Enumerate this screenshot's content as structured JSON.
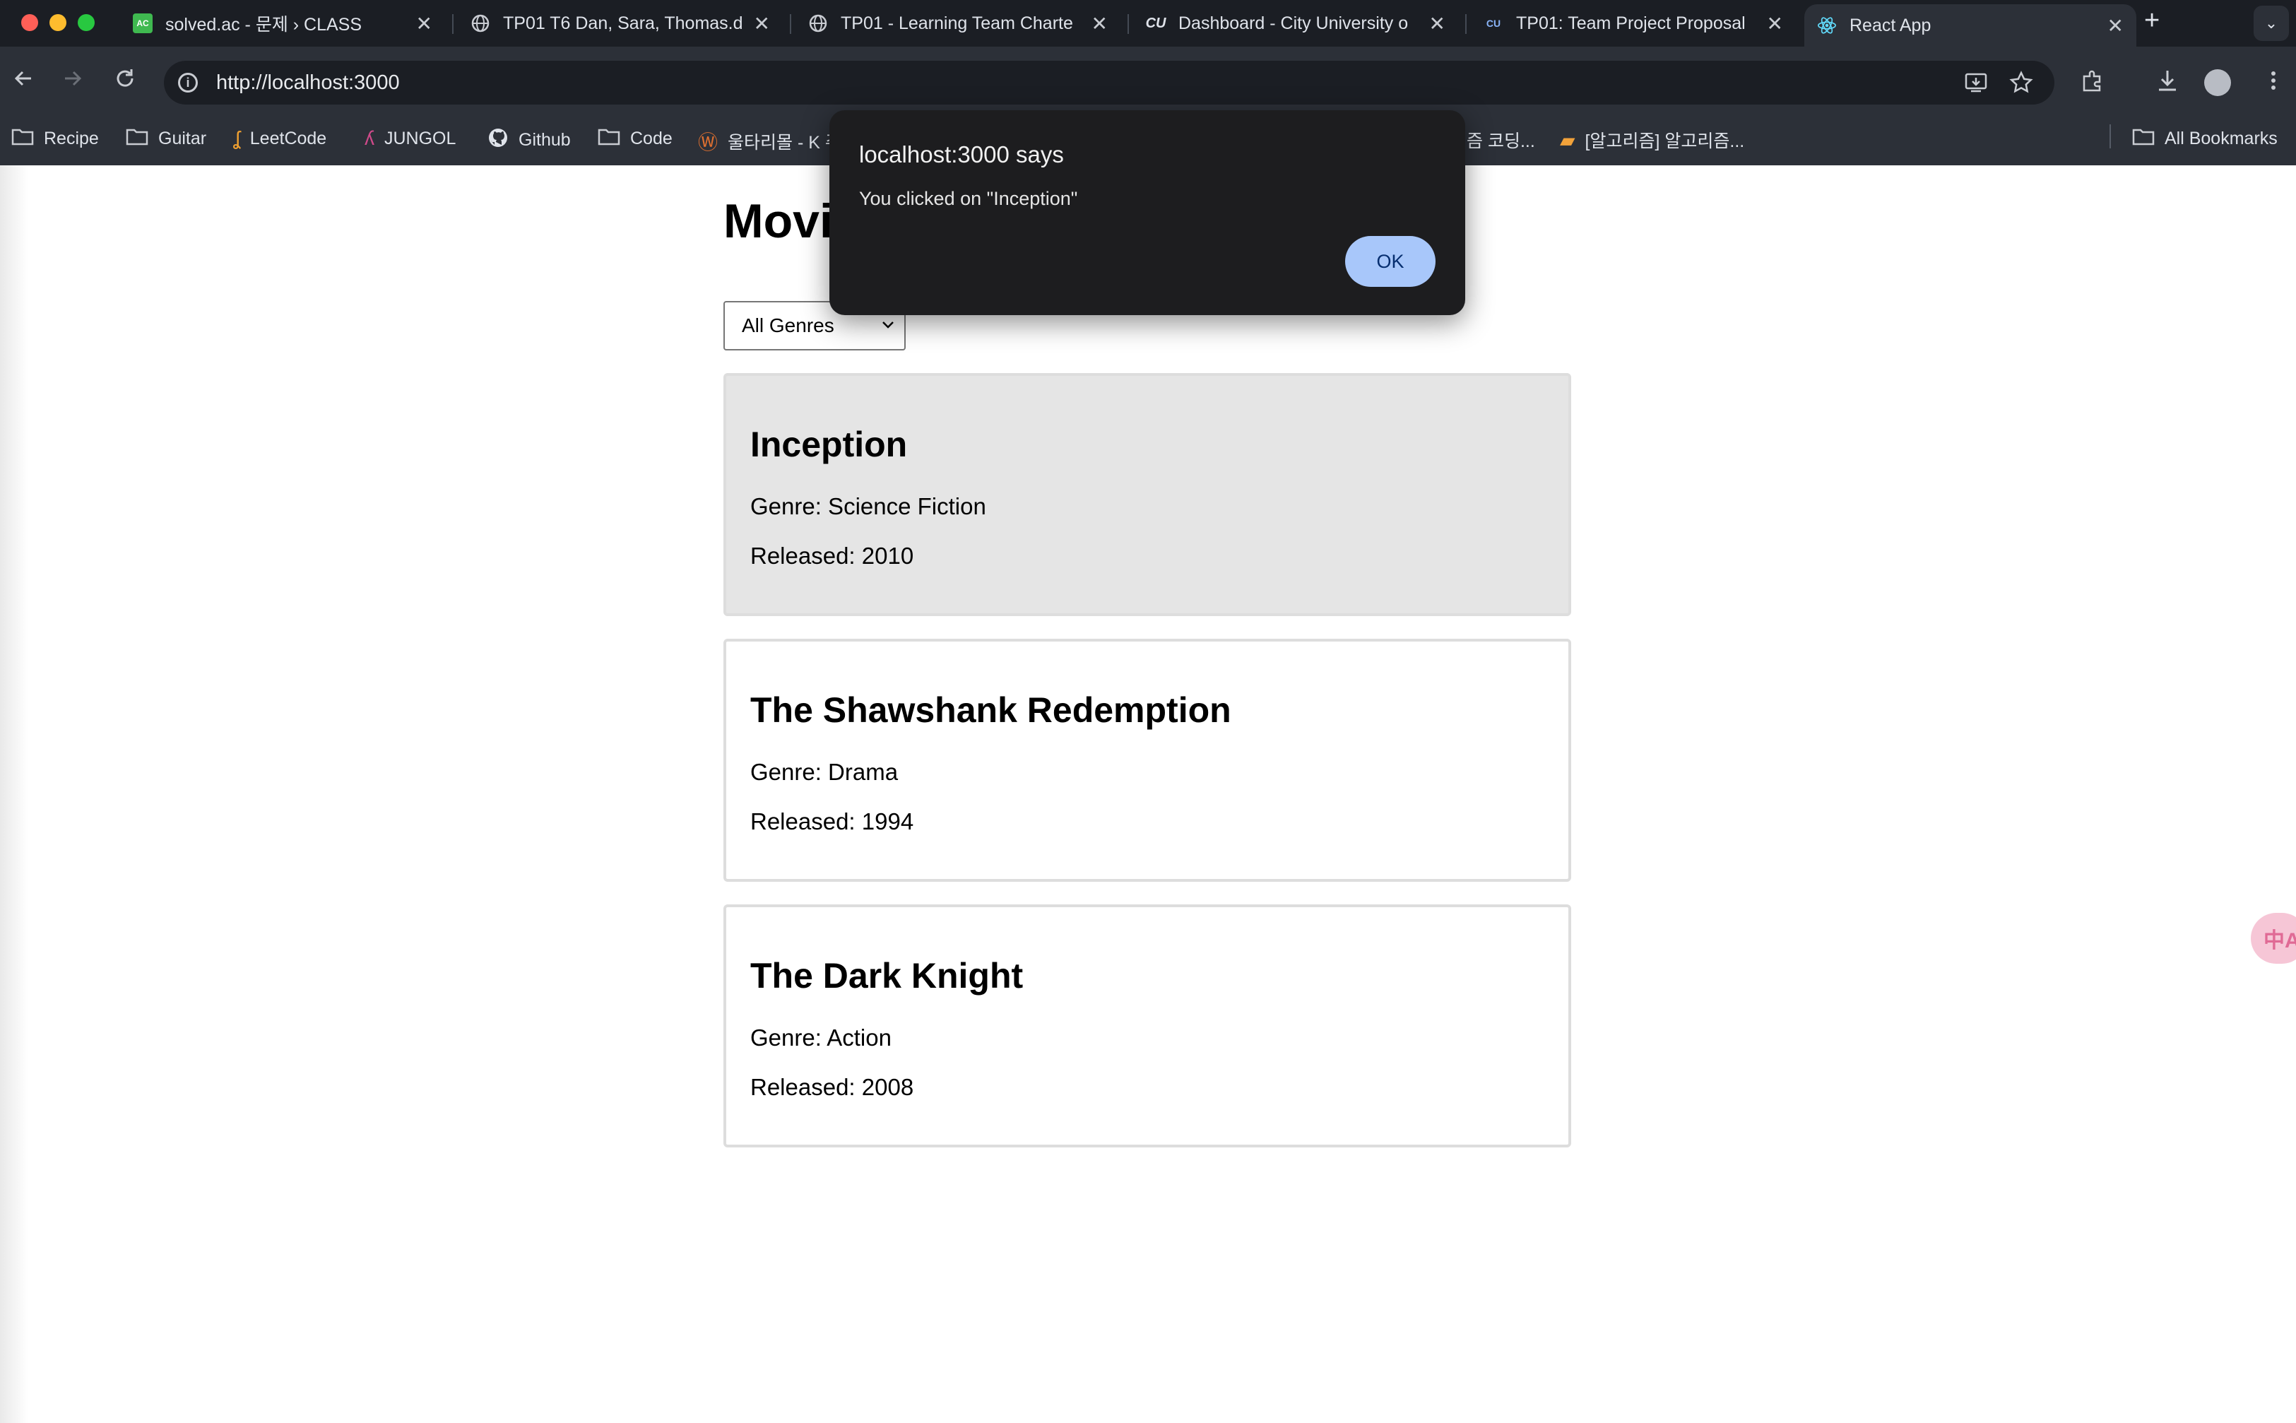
{
  "browser": {
    "tabs": [
      {
        "title": "solved.ac - 문제 › CLASS",
        "favicon": "AC",
        "active": false
      },
      {
        "title": "TP01 T6 Dan, Sara, Thomas.d",
        "favicon": "globe-icon",
        "active": false
      },
      {
        "title": "TP01 - Learning Team Charte",
        "favicon": "globe-icon",
        "active": false
      },
      {
        "title": "Dashboard - City University o",
        "favicon": "CU",
        "active": false
      },
      {
        "title": "TP01: Team Project Proposal",
        "favicon": "CU",
        "active": false
      },
      {
        "title": "React App",
        "favicon": "react-icon",
        "active": true
      }
    ],
    "new_tab": "+",
    "url": "http://localhost:3000",
    "bookmarks": [
      {
        "label": "Recipe",
        "icon": "folder-icon"
      },
      {
        "label": "Guitar",
        "icon": "folder-icon"
      },
      {
        "label": "LeetCode",
        "icon": "leetcode-icon"
      },
      {
        "label": "JUNGOL",
        "icon": "jungol-icon"
      },
      {
        "label": "Github",
        "icon": "github-icon"
      },
      {
        "label": "Code",
        "icon": "folder-icon"
      },
      {
        "label": "울타리몰 - K 주",
        "icon": "w-icon"
      },
      {
        "label": "즘 코딩...",
        "icon": ""
      },
      {
        "label": "[알고리즘] 알고리즘...",
        "icon": "bookmark-favicon"
      }
    ],
    "all_bookmarks": "All Bookmarks"
  },
  "app": {
    "title": "Movi",
    "genre_filter": {
      "selected": "All Genres"
    },
    "movies": [
      {
        "title": "Inception",
        "genre": "Genre: Science Fiction",
        "released": "Released: 2010",
        "selected": true
      },
      {
        "title": "The Shawshank Redemption",
        "genre": "Genre: Drama",
        "released": "Released: 1994",
        "selected": false
      },
      {
        "title": "The Dark Knight",
        "genre": "Genre: Action",
        "released": "Released: 2008",
        "selected": false
      }
    ]
  },
  "dialog": {
    "title": "localhost:3000 says",
    "message": "You clicked on \"Inception\"",
    "ok_label": "OK"
  },
  "translate_fab": "中A",
  "colors": {
    "chrome_bg": "#2c3038",
    "tabstrip_bg": "#1b1e24",
    "dialog_bg": "#1d1d1f",
    "ok_button": "#a8c7fa",
    "selected_card": "#e5e5e5"
  }
}
